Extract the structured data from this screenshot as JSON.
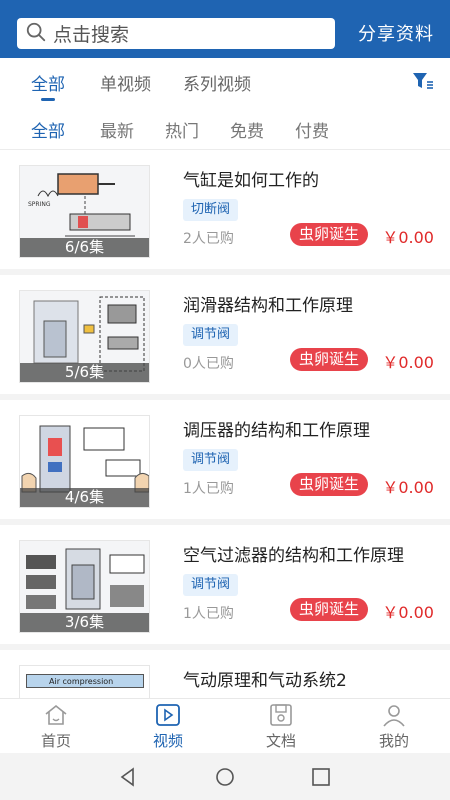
{
  "search": {
    "placeholder": "点击搜索"
  },
  "header": {
    "share_label": "分享资料"
  },
  "top_tabs": [
    {
      "label": "全部"
    },
    {
      "label": "单视频"
    },
    {
      "label": "系列视频"
    }
  ],
  "sub_tabs": [
    {
      "label": "全部"
    },
    {
      "label": "最新"
    },
    {
      "label": "热门"
    },
    {
      "label": "免费"
    },
    {
      "label": "付费"
    }
  ],
  "items": [
    {
      "title": "气缸是如何工作的",
      "tag": "切断阀",
      "bought": "2人已购",
      "author": "虫卵诞生",
      "price": "￥0.00",
      "episodes": "6/6集"
    },
    {
      "title": "润滑器结构和工作原理",
      "tag": "调节阀",
      "bought": "0人已购",
      "author": "虫卵诞生",
      "price": "￥0.00",
      "episodes": "5/6集"
    },
    {
      "title": "调压器的结构和工作原理",
      "tag": "调节阀",
      "bought": "1人已购",
      "author": "虫卵诞生",
      "price": "￥0.00",
      "episodes": "4/6集"
    },
    {
      "title": "空气过滤器的结构和工作原理",
      "tag": "调节阀",
      "bought": "1人已购",
      "author": "虫卵诞生",
      "price": "￥0.00",
      "episodes": "3/6集"
    },
    {
      "title": "气动原理和气动系统2",
      "thumb_text": "Air compression"
    }
  ],
  "bottom_nav": [
    {
      "label": "首页",
      "icon": "home-icon"
    },
    {
      "label": "视频",
      "icon": "video-icon"
    },
    {
      "label": "文档",
      "icon": "document-icon"
    },
    {
      "label": "我的",
      "icon": "profile-icon"
    }
  ],
  "colors": {
    "primary": "#1f64b2",
    "badge": "#e8434b",
    "price": "#e02a2a"
  }
}
